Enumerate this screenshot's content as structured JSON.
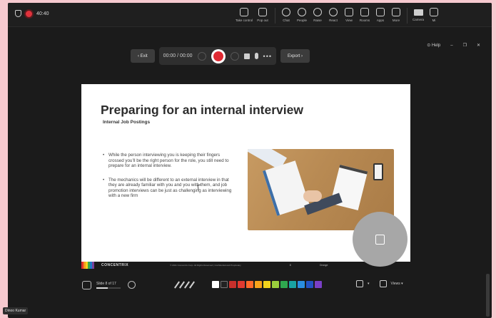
{
  "status": {
    "timer": "40:40"
  },
  "toolbar": {
    "items": [
      {
        "label": "Take control",
        "icon": "take-control-icon"
      },
      {
        "label": "Pop out",
        "icon": "pop-out-icon"
      },
      {
        "label": "Chat",
        "icon": "chat-icon"
      },
      {
        "label": "People",
        "icon": "people-icon"
      },
      {
        "label": "Raise",
        "icon": "raise-hand-icon"
      },
      {
        "label": "React",
        "icon": "react-icon"
      },
      {
        "label": "View",
        "icon": "view-icon"
      },
      {
        "label": "Rooms",
        "icon": "rooms-icon"
      },
      {
        "label": "Apps",
        "icon": "apps-icon"
      },
      {
        "label": "More",
        "icon": "more-icon"
      },
      {
        "label": "Camera",
        "icon": "camera-icon"
      },
      {
        "label": "Mi",
        "icon": "mic-icon"
      }
    ]
  },
  "recorder": {
    "exit_label": "‹ Exit",
    "time": "00:00 / 00:00",
    "export_label": "Export ›",
    "more": "•••"
  },
  "window": {
    "help_label": "Help",
    "min": "–",
    "restore": "❐",
    "close": "✕"
  },
  "slide": {
    "title": "Preparing for an internal interview",
    "subtitle": "Internal Job Postings",
    "bullets": [
      "While the person interviewing you is keeping their fingers crossed you’ll be the right person for the role, you still need to prepare for an internal interview.",
      "The mechanics will be different to an external interview in that they are already familiar with you and you with them, and job promotion interviews can be just as challenging as interviewing with a new firm"
    ],
    "brand": "CONCENTRIX",
    "copyright": "© 2021 Concentrix Corp. All Rights Reserved | Confidential and Proprietary",
    "page": "8",
    "footer_logo": "Orange"
  },
  "bottom_bar": {
    "slide_of": "Slide 8 of 17",
    "progress": 0.47,
    "views_label": "Views ▾",
    "swatches": [
      "#ffffff",
      "#222222",
      "#c8302c",
      "#e03a30",
      "#ff6a2a",
      "#f7a21b",
      "#f2d21c",
      "#9bcf3c",
      "#2fa84f",
      "#19a3a3",
      "#2a8ee0",
      "#2353c4",
      "#7a3fc7"
    ]
  },
  "participant": {
    "name": "Dinoo Kumar"
  }
}
